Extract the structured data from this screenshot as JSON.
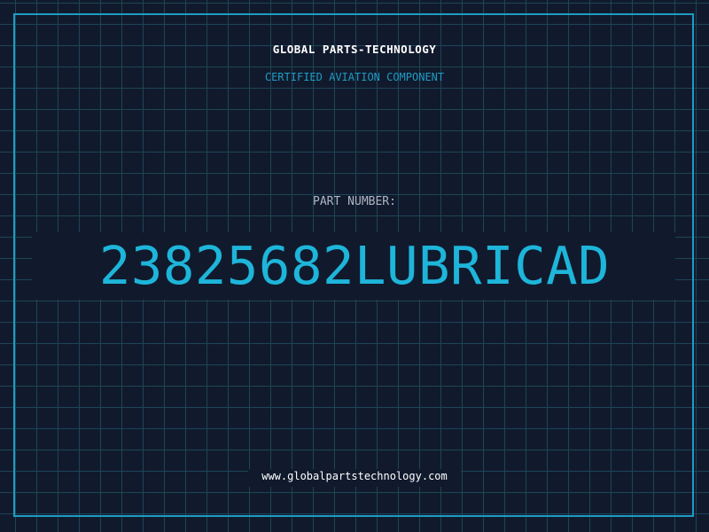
{
  "label": {
    "company": "GLOBAL PARTS-TECHNOLOGY",
    "subtitle": "CERTIFIED AVIATION COMPONENT",
    "part_number_label": "PART NUMBER:",
    "part_number": "23825682LUBRICAD",
    "website": "www.globalpartstechnology.com"
  },
  "colors": {
    "background": "#111a2d",
    "grid": "#1d4456",
    "accent": "#1eb5da",
    "border": "#1e9cc2",
    "text": "#ffffff",
    "muted_text": "#aeb6c4"
  }
}
